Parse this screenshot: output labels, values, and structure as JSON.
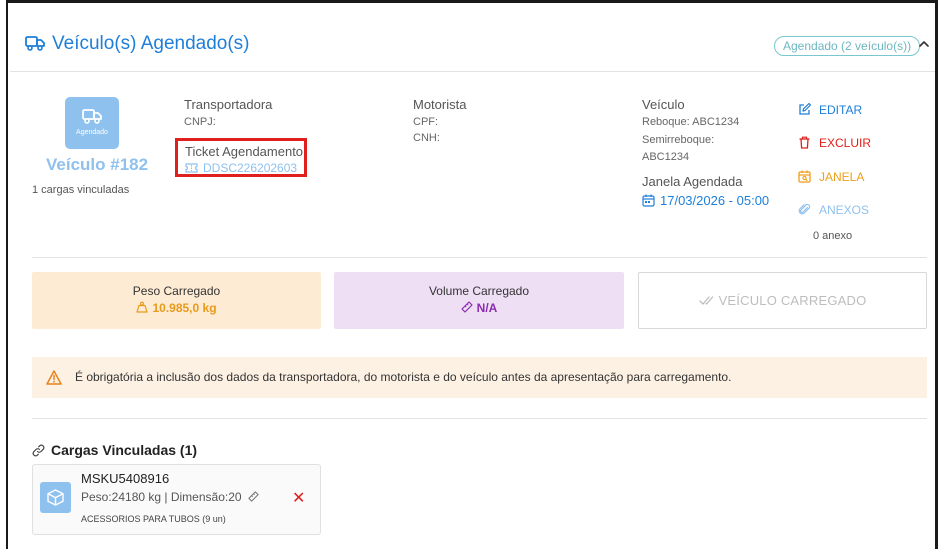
{
  "header": {
    "title": "Veículo(s) Agendado(s)",
    "status_pill": "Agendado (2 veículo(s))"
  },
  "vehicle": {
    "tile_label": "Agendado",
    "name": "Veículo #182",
    "cargas_count_text": "1 cargas vinculadas"
  },
  "transportadora": {
    "label": "Transportadora",
    "cnpj_label": "CNPJ:"
  },
  "ticket": {
    "label": "Ticket Agendamento",
    "value": "DDSC226202603"
  },
  "motorista": {
    "label": "Motorista",
    "cpf_label": "CPF:",
    "cnh_label": "CNH:"
  },
  "veiculo_info": {
    "label": "Veículo",
    "reboque": "Reboque: ABC1234",
    "semirreboque_label": "Semirreboque:",
    "semirreboque_value": "ABC1234",
    "janela_label": "Janela Agendada",
    "janela_value": "17/03/2026 - 05:00"
  },
  "actions": {
    "edit": "EDITAR",
    "delete": "EXCLUIR",
    "janela": "JANELA",
    "anexos": "ANEXOS",
    "anexo_count": "0 anexo"
  },
  "summary": {
    "peso_title": "Peso Carregado",
    "peso_value": "10.985,0 kg",
    "volume_title": "Volume Carregado",
    "volume_value": "N/A",
    "carregado_button": "VEÍCULO CARREGADO"
  },
  "warning": {
    "text": "É obrigatória a inclusão dos dados da transportadora, do motorista e do veículo antes da apresentação para carregamento."
  },
  "cargas": {
    "title": "Cargas Vinculadas (1)",
    "items": [
      {
        "code": "MSKU5408916",
        "meta": "Peso:24180 kg | Dimensão:20",
        "description": "ACESSORIOS PARA TUBOS (9 un)"
      }
    ]
  },
  "colors": {
    "primary_blue": "#1e7fd8",
    "light_blue": "#8fc1ee",
    "danger_red": "#e0201c",
    "warning_orange": "#ef9f1a",
    "purple": "#8b2bb0"
  },
  "icons": [
    "truck-icon",
    "chevron-up-icon",
    "ticket-icon",
    "calendar-icon",
    "edit-icon",
    "trash-icon",
    "calendar-search-icon",
    "paperclip-icon",
    "weight-icon",
    "ruler-icon",
    "double-check-icon",
    "warning-icon",
    "link-icon",
    "package-icon",
    "close-icon"
  ]
}
